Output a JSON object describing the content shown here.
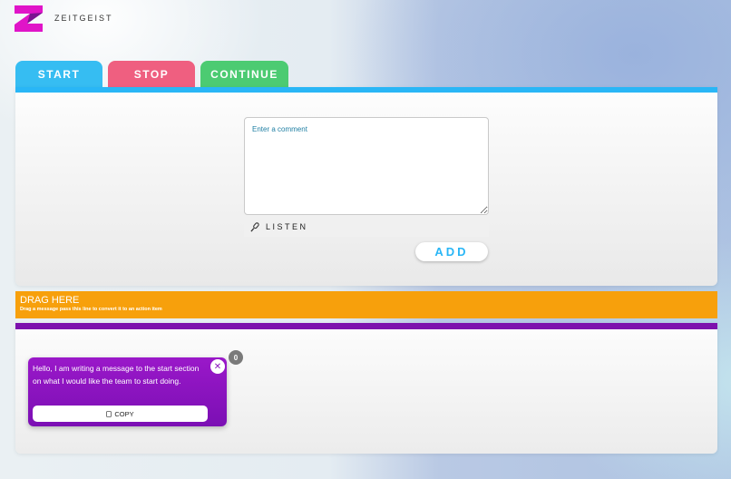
{
  "brand": {
    "name": "ZEITGEIST",
    "logo_icon": "zeitgeist-logo",
    "logo_color": "#e014c8"
  },
  "tabs": [
    {
      "label": "START",
      "color": "#36bdf2"
    },
    {
      "label": "STOP",
      "color": "#ef5f80"
    },
    {
      "label": "CONTINUE",
      "color": "#4ccb72"
    }
  ],
  "comment": {
    "placeholder": "Enter a comment",
    "value": ""
  },
  "listen": {
    "label": "LISTEN",
    "icon": "microphone-icon"
  },
  "add_button": {
    "label": "ADD"
  },
  "drag_zone": {
    "title": "DRAG HERE",
    "subtitle": "Drag a message pass this line to convert it to an action item"
  },
  "message_card": {
    "text": "Hello, I am writing a message to the start section on what I would like the team to start doing.",
    "copy_label": "COPY",
    "close_icon": "close-icon",
    "count": "0"
  }
}
